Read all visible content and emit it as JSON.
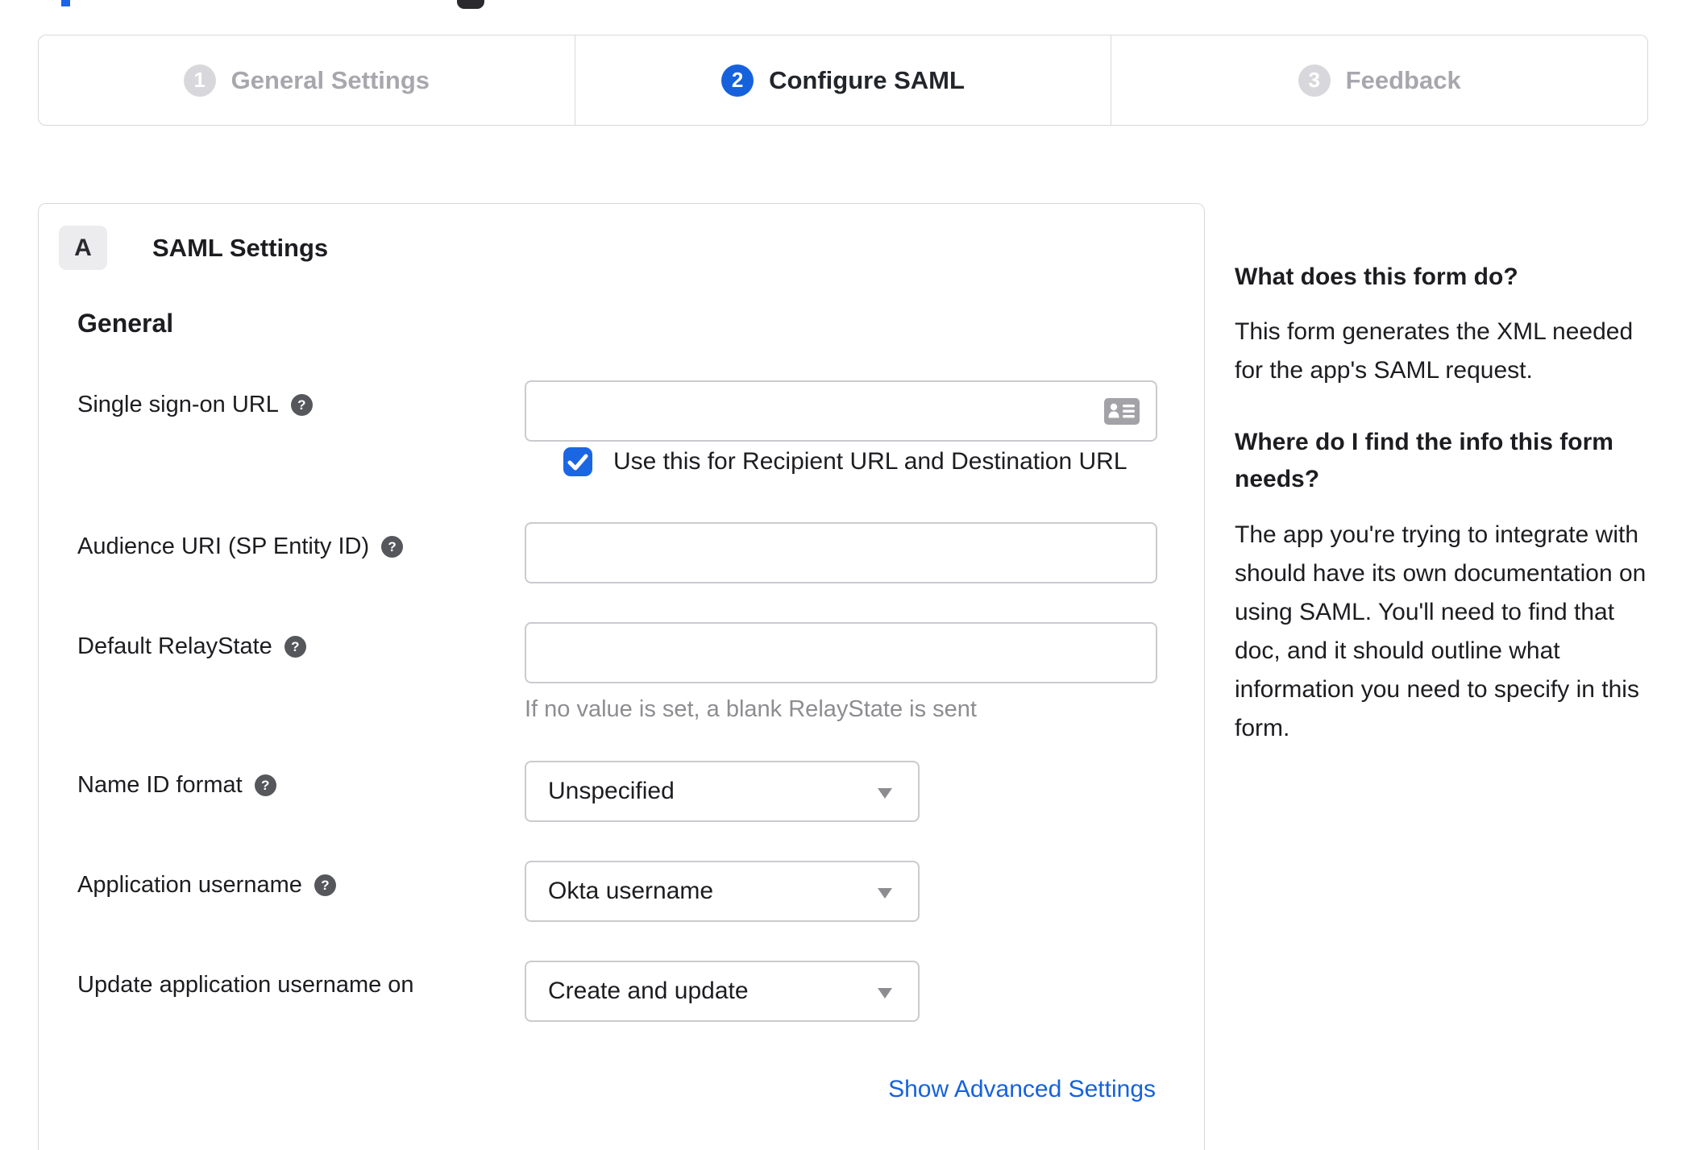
{
  "colors": {
    "accent_blue": "#1662dd",
    "checkbox_blue": "#1b66e3",
    "active_text": "#1d1d21",
    "inactive_gray": "#a7a7ad",
    "border_gray": "#d8d8dc",
    "input_border": "#cbcbcf",
    "helper_gray": "#8d8d91",
    "help_icon_bg": "#55575c"
  },
  "stepper": {
    "steps": [
      {
        "number": "1",
        "label": "General Settings",
        "active": false
      },
      {
        "number": "2",
        "label": "Configure SAML",
        "active": true
      },
      {
        "number": "3",
        "label": "Feedback",
        "active": false
      }
    ]
  },
  "panel": {
    "badge": "A",
    "title": "SAML Settings",
    "section_heading": "General",
    "help_glyph": "?",
    "fields": {
      "sso": {
        "label": "Single sign-on URL",
        "value": "",
        "checkbox_checked": true,
        "checkbox_label": "Use this for Recipient URL and Destination URL"
      },
      "audience": {
        "label": "Audience URI (SP Entity ID)",
        "value": ""
      },
      "relay": {
        "label": "Default RelayState",
        "value": "",
        "helper": "If no value is set, a blank RelayState is sent"
      },
      "nameid": {
        "label": "Name ID format",
        "value": "Unspecified"
      },
      "appuser": {
        "label": "Application username",
        "value": "Okta username"
      },
      "update": {
        "label": "Update application username on",
        "value": "Create and update"
      }
    },
    "advanced_link": "Show Advanced Settings"
  },
  "sidebar": {
    "heading1": "What does this form do?",
    "para1": "This form generates the XML needed for the app's SAML request.",
    "heading2": "Where do I find the info this form needs?",
    "para2": "The app you're trying to integrate with should have its own documentation on using SAML. You'll need to find that doc, and it should outline what information you need to specify in this form."
  }
}
